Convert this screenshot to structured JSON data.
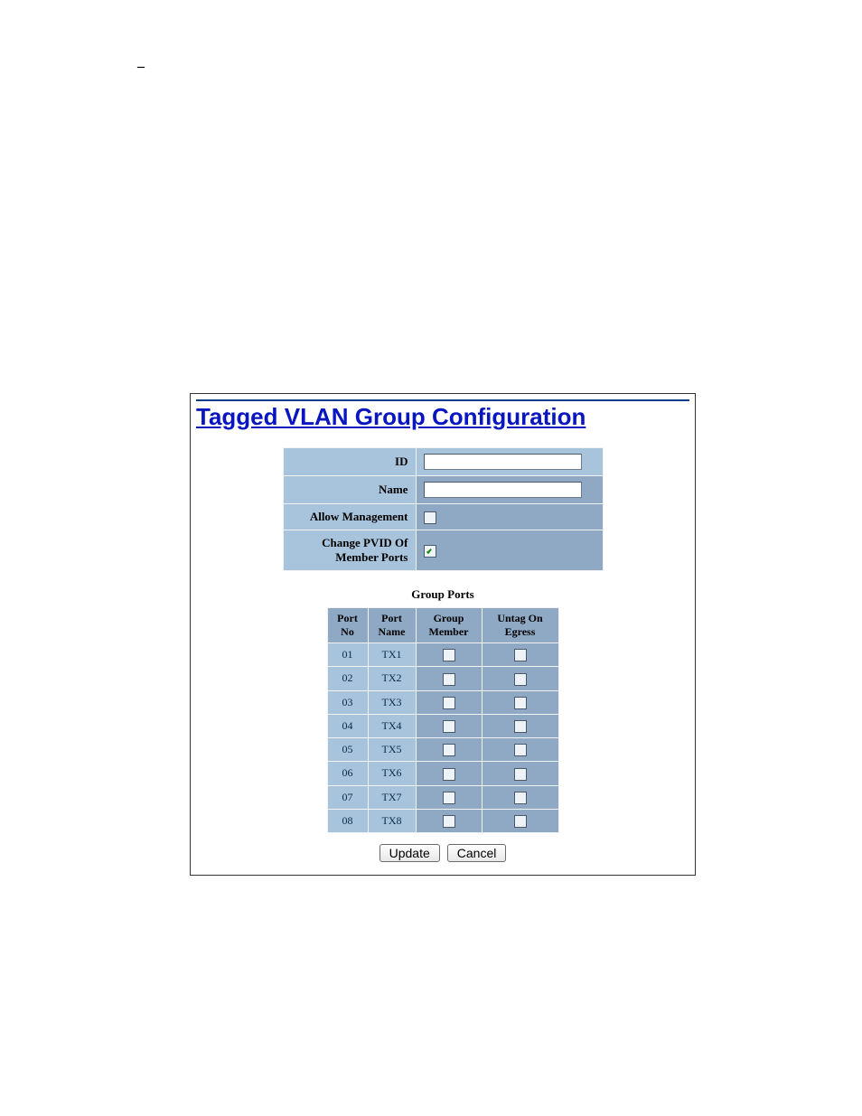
{
  "dash": "–",
  "title": "Tagged VLAN Group Configuration",
  "config": {
    "id_label": "ID",
    "id_value": "",
    "name_label": "Name",
    "name_value": "",
    "allow_mgmt_label": "Allow Management",
    "allow_mgmt_checked": false,
    "change_pvid_label_line1": "Change PVID Of",
    "change_pvid_label_line2": "Member Ports",
    "change_pvid_checked": true
  },
  "group_ports_caption": "Group Ports",
  "columns": {
    "port_no": "Port No",
    "port_name": "Port Name",
    "group_member": "Group Member",
    "untag_on_egress": "Untag On Egress"
  },
  "rows": [
    {
      "no": "01",
      "name": "TX1",
      "member": false,
      "untag": false
    },
    {
      "no": "02",
      "name": "TX2",
      "member": false,
      "untag": false
    },
    {
      "no": "03",
      "name": "TX3",
      "member": false,
      "untag": false
    },
    {
      "no": "04",
      "name": "TX4",
      "member": false,
      "untag": false
    },
    {
      "no": "05",
      "name": "TX5",
      "member": false,
      "untag": false
    },
    {
      "no": "06",
      "name": "TX6",
      "member": false,
      "untag": false
    },
    {
      "no": "07",
      "name": "TX7",
      "member": false,
      "untag": false
    },
    {
      "no": "08",
      "name": "TX8",
      "member": false,
      "untag": false
    }
  ],
  "buttons": {
    "update": "Update",
    "cancel": "Cancel"
  }
}
